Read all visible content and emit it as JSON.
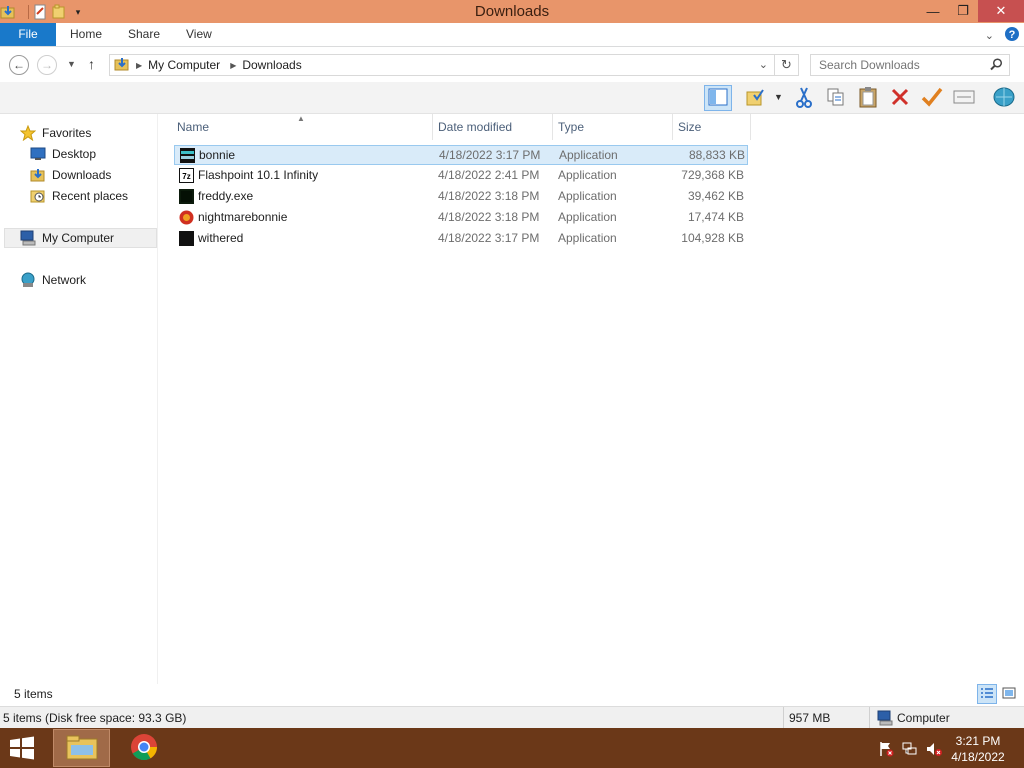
{
  "window": {
    "title": "Downloads",
    "minimize_glyph": "—",
    "maximize_glyph": "❐",
    "close_glyph": "✕"
  },
  "ribbon": {
    "tabs": [
      {
        "label": "File"
      },
      {
        "label": "Home"
      },
      {
        "label": "Share"
      },
      {
        "label": "View"
      }
    ]
  },
  "address": {
    "crumbs": [
      "My Computer",
      "Downloads"
    ],
    "search_placeholder": "Search Downloads"
  },
  "navpane": {
    "favorites": "Favorites",
    "desktop": "Desktop",
    "downloads": "Downloads",
    "recent": "Recent places",
    "computer": "My Computer",
    "network": "Network"
  },
  "filelist": {
    "columns": {
      "name": "Name",
      "date": "Date modified",
      "type": "Type",
      "size": "Size"
    },
    "rows": [
      {
        "name": "bonnie",
        "date": "4/18/2022 3:17 PM",
        "type": "Application",
        "size": "88,833 KB",
        "selected": true
      },
      {
        "name": "Flashpoint 10.1 Infinity",
        "date": "4/18/2022 2:41 PM",
        "type": "Application",
        "size": "729,368 KB",
        "selected": false
      },
      {
        "name": "freddy.exe",
        "date": "4/18/2022 3:18 PM",
        "type": "Application",
        "size": "39,462 KB",
        "selected": false
      },
      {
        "name": "nightmarebonnie",
        "date": "4/18/2022 3:18 PM",
        "type": "Application",
        "size": "17,474 KB",
        "selected": false
      },
      {
        "name": "withered",
        "date": "4/18/2022 3:17 PM",
        "type": "Application",
        "size": "104,928 KB",
        "selected": false
      }
    ]
  },
  "status": {
    "item_count": "5 items",
    "details": "5 items (Disk free space: 93.3 GB)",
    "selection_size": "957 MB",
    "location": "Computer"
  },
  "taskbar": {
    "time": "3:21 PM",
    "date": "4/18/2022"
  },
  "colors": {
    "titlebar": "#e8956a",
    "file_tab": "#1979ca",
    "taskbar": "#6b3818",
    "selection": "#d9ebf9"
  }
}
